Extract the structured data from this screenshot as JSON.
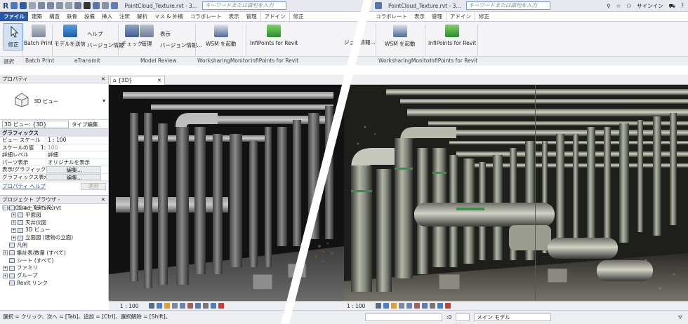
{
  "left": {
    "app_logo": "R",
    "title": "PointCloud_Texture.rvt - 3...",
    "search_placeholder": "キーワードまたは語句を入力",
    "tabs": [
      "ファイル",
      "建築",
      "構造",
      "鉄骨",
      "設備",
      "挿入",
      "注釈",
      "解析",
      "マス & 外構",
      "コラボレート",
      "表示",
      "管理",
      "アドイン",
      "修正"
    ],
    "ribbon": {
      "modify": "修正",
      "batch_print": "Batch Print",
      "send_model": "モデルを送信",
      "help": "ヘルプ",
      "version_info": "バージョン情報",
      "check": "チェック",
      "manage": "管理",
      "display": "表示",
      "version_info2": "バージョン情報...",
      "wsm_start": "WSM を起動",
      "infipoints": "InfiPoints for Revit"
    },
    "panel_labels": {
      "select": "選択",
      "batch_print": "Batch Print",
      "etransmit": "eTransmit",
      "model_review": "Model Review",
      "worksharing_monitor": "WorksharingMonitor",
      "infipoints": "InfiPoints for Revit"
    },
    "properties": {
      "title": "プロパティ",
      "type_name": "3D ビュー",
      "selector": "3D ビュー: {3D}",
      "type_edit": "タイプ編集",
      "group": "グラフィックス",
      "rows": [
        {
          "k": "ビュー スケール",
          "v": "1 : 100"
        },
        {
          "k": "スケールの値 　1:",
          "v": "100"
        },
        {
          "k": "詳細レベル",
          "v": "詳細"
        },
        {
          "k": "パーツ表示",
          "v": "オリジナルを表示"
        },
        {
          "k": "表示/グラフィックス...",
          "v": "編集..."
        },
        {
          "k": "グラフィックス表示オ...",
          "v": "編集..."
        }
      ],
      "help": "プロパティ ヘルプ",
      "apply": "適用"
    },
    "browser": {
      "title": "プロジェクト ブラウザ - PointCloud_Texture.rvt",
      "nodes": [
        {
          "label": "ビュー (すべて)",
          "depth": 0,
          "exp": "−"
        },
        {
          "label": "平面図",
          "depth": 1,
          "exp": "+"
        },
        {
          "label": "天井伏図",
          "depth": 1,
          "exp": "+"
        },
        {
          "label": "3D ビュー",
          "depth": 1,
          "exp": "+"
        },
        {
          "label": "立面図 (建物の立面)",
          "depth": 1,
          "exp": "+"
        },
        {
          "label": "凡例",
          "depth": 0,
          "exp": ""
        },
        {
          "label": "集計表/数量 (すべて)",
          "depth": 0,
          "exp": "+"
        },
        {
          "label": "シート (すべて)",
          "depth": 0,
          "exp": ""
        },
        {
          "label": "ファミリ",
          "depth": 0,
          "exp": "+"
        },
        {
          "label": "グループ",
          "depth": 0,
          "exp": "+"
        },
        {
          "label": "Revit リンク",
          "depth": 0,
          "exp": ""
        }
      ]
    },
    "view_tab": "{3D}",
    "scale": "1 : 100",
    "status": "選択 = クリック、次へ = [Tab]、追加 = [Ctrl]、選択解除 = [Shift]。"
  },
  "right": {
    "title": "PointCloud_Texture.rvt - 3...",
    "search_placeholder": "キーワードまたは語句を入力",
    "signin": "サインイン",
    "tabs": [
      "コラボレート",
      "表示",
      "管理",
      "アドイン",
      "修正"
    ],
    "ribbon": {
      "partial_label": "ジョン情報...",
      "wsm_start": "WSM を起動",
      "infipoints": "InfiPoints for Revit"
    },
    "panel_labels": {
      "worksharing_monitor": "WorksharingMonitor",
      "infipoints": "InfiPoints for Revit"
    },
    "scale": "1 : 100",
    "status_zero": ":0",
    "main_model": "メイン モデル"
  }
}
